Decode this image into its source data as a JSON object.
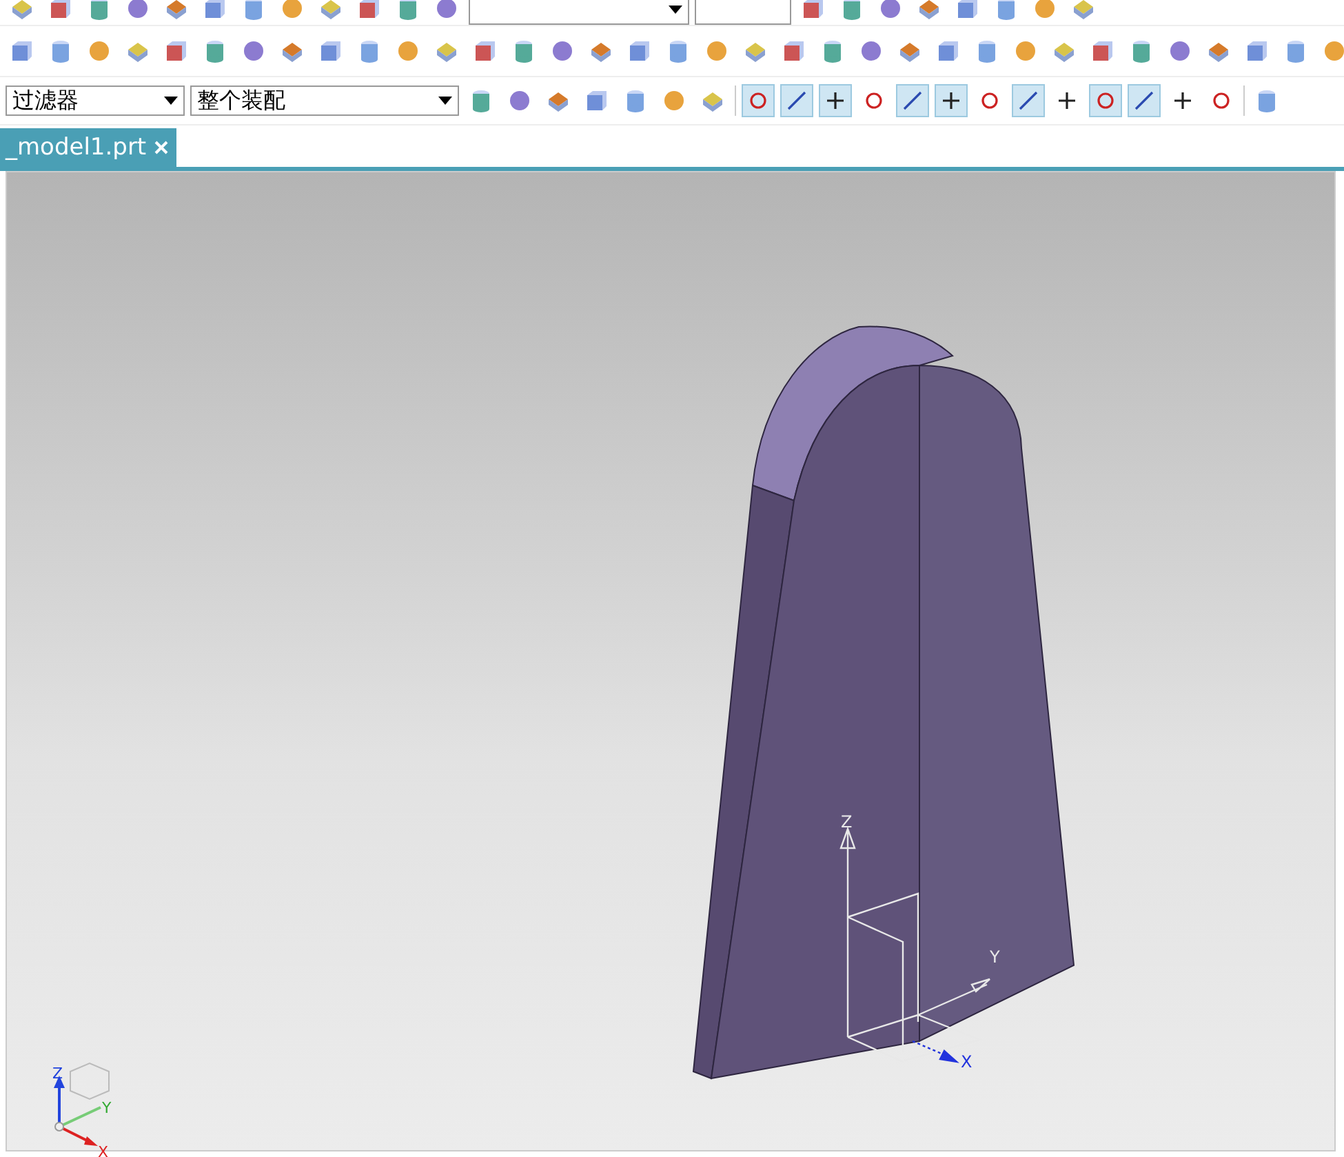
{
  "selection_bar": {
    "filter": {
      "value": "过滤器"
    },
    "scope": {
      "value": "整个装配"
    },
    "snap_tools": [
      {
        "on": true
      },
      {
        "on": true
      },
      {
        "on": true
      },
      {
        "on": false
      },
      {
        "on": true
      },
      {
        "on": true
      },
      {
        "on": false
      },
      {
        "on": true
      },
      {
        "on": false
      },
      {
        "on": true
      },
      {
        "on": true
      },
      {
        "on": false
      },
      {
        "on": false
      }
    ]
  },
  "tabs": [
    {
      "label": "_model1.prt",
      "selected": true
    }
  ],
  "viewport": {
    "csys_labels": [
      "Z",
      "Y",
      "X"
    ],
    "view_triad_labels": [
      "Z",
      "Y",
      "X"
    ]
  }
}
